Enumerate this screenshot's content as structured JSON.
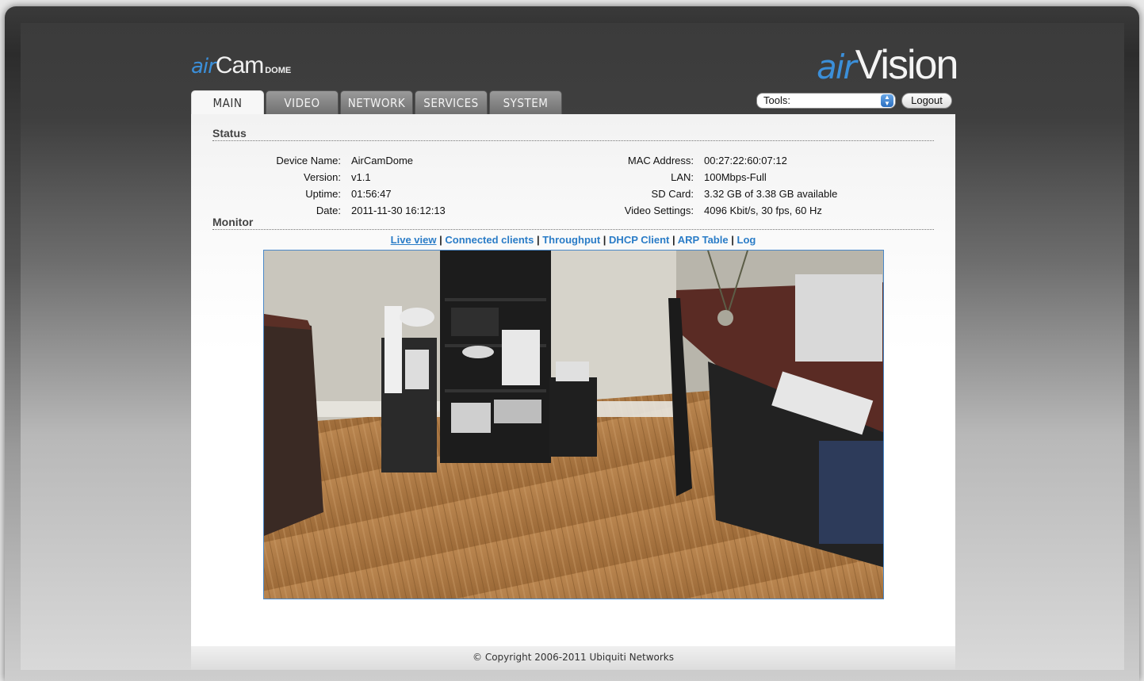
{
  "header": {
    "product_logo": {
      "prefix": "air",
      "name": "Cam",
      "suffix": "DOME"
    },
    "brand_logo": {
      "prefix": "air",
      "name": "Vision"
    },
    "tools_label": "Tools:",
    "logout_label": "Logout"
  },
  "tabs": [
    {
      "label": "MAIN",
      "active": true
    },
    {
      "label": "VIDEO",
      "active": false
    },
    {
      "label": "NETWORK",
      "active": false
    },
    {
      "label": "SERVICES",
      "active": false
    },
    {
      "label": "SYSTEM",
      "active": false
    }
  ],
  "status": {
    "title": "Status",
    "left": [
      {
        "label": "Device Name:",
        "value": "AirCamDome"
      },
      {
        "label": "Version:",
        "value": "v1.1"
      },
      {
        "label": "Uptime:",
        "value": "01:56:47"
      },
      {
        "label": "Date:",
        "value": "2011-11-30 16:12:13"
      }
    ],
    "right": [
      {
        "label": "MAC Address:",
        "value": "00:27:22:60:07:12"
      },
      {
        "label": "LAN:",
        "value": "100Mbps-Full"
      },
      {
        "label": "SD Card:",
        "value": "3.32 GB of 3.38 GB available"
      },
      {
        "label": "Video Settings:",
        "value": "4096 Kbit/s, 30 fps, 60 Hz"
      }
    ]
  },
  "monitor": {
    "title": "Monitor",
    "links": [
      "Live view",
      "Connected clients",
      "Throughput",
      "DHCP Client",
      "ARP Table",
      "Log"
    ],
    "separator": "|"
  },
  "footer": {
    "copyright": "© Copyright 2006-2011 Ubiquiti Networks"
  },
  "colors": {
    "accent": "#2a7cc7",
    "logo_blue": "#3b8fd9"
  },
  "icons": {
    "tools_dropdown": "updown-arrows-icon"
  }
}
